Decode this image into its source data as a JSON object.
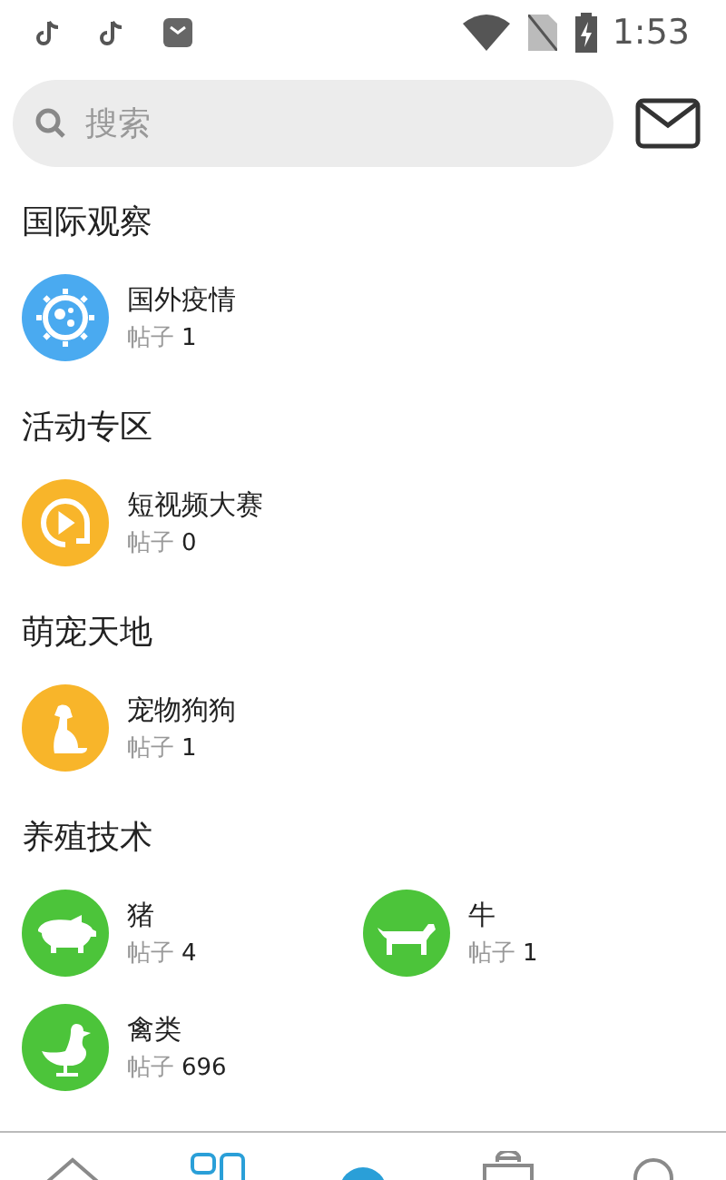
{
  "status_bar": {
    "time": "1:53"
  },
  "search": {
    "placeholder": "搜索"
  },
  "sections": [
    {
      "title": "国际观察",
      "items": [
        {
          "kind": "virus",
          "color": "#4aaaf0",
          "name": "国外疫情",
          "count_label": "帖子",
          "count": "1"
        }
      ]
    },
    {
      "title": "活动专区",
      "items": [
        {
          "kind": "video",
          "color": "#f8b52a",
          "name": "短视频大赛",
          "count_label": "帖子",
          "count": "0"
        }
      ]
    },
    {
      "title": "萌宠天地",
      "items": [
        {
          "kind": "dog",
          "color": "#f8b52a",
          "name": "宠物狗狗",
          "count_label": "帖子",
          "count": "1"
        }
      ]
    },
    {
      "title": "养殖技术",
      "items": [
        {
          "kind": "pig",
          "color": "#4cc43a",
          "name": "猪",
          "count_label": "帖子",
          "count": "4"
        },
        {
          "kind": "cow",
          "color": "#4cc43a",
          "name": "牛",
          "count_label": "帖子",
          "count": "1"
        },
        {
          "kind": "bird",
          "color": "#4cc43a",
          "name": "禽类",
          "count_label": "帖子",
          "count": "696"
        }
      ]
    }
  ],
  "nav": [
    {
      "kind": "home",
      "selected": false
    },
    {
      "kind": "grid",
      "selected": true
    },
    {
      "kind": "center",
      "selected": false
    },
    {
      "kind": "bag",
      "selected": false
    },
    {
      "kind": "person",
      "selected": false
    }
  ]
}
